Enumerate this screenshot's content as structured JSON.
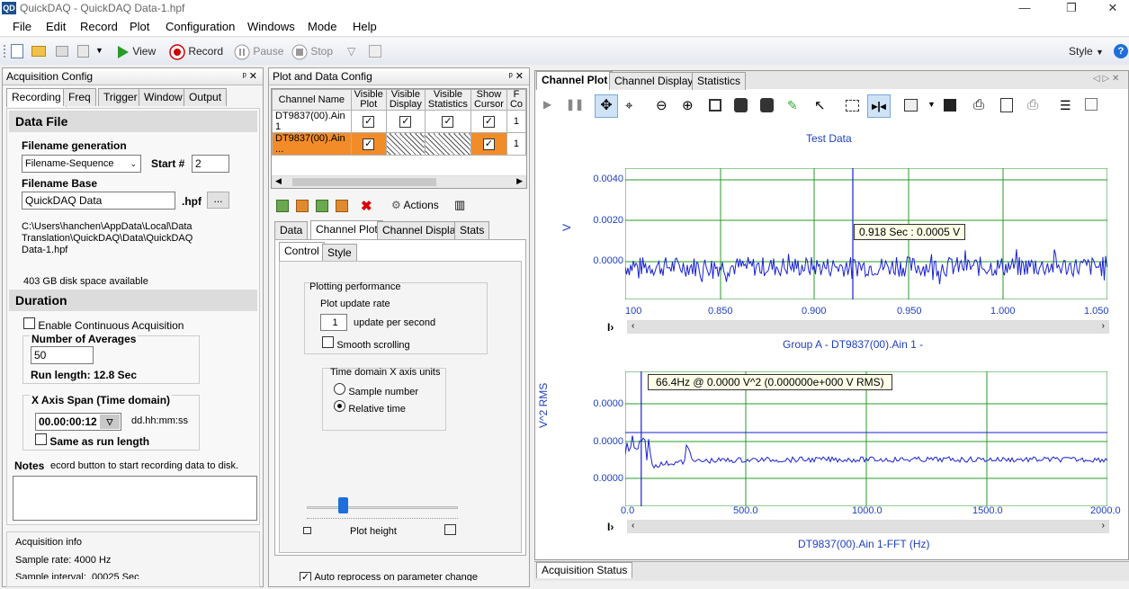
{
  "window": {
    "title": "QuickDAQ - QuickDAQ Data-1.hpf",
    "icon_text": "QD",
    "controls": [
      "—",
      "❐",
      "✕"
    ]
  },
  "menu": [
    "File",
    "Edit",
    "Record",
    "Plot",
    "Configuration",
    "Windows",
    "Mode",
    "Help"
  ],
  "toolbar": {
    "view": "View",
    "record": "Record",
    "pause": "Pause",
    "stop": "Stop",
    "style": "Style"
  },
  "acq_config": {
    "title": "Acquisition Config",
    "tabs": [
      "Recording",
      "Freq",
      "Trigger",
      "Window",
      "Output"
    ],
    "data_file": "Data File",
    "filename_generation": "Filename generation",
    "filename_mode": "Filename-Sequence",
    "start_label": "Start #",
    "start_value": "2",
    "filename_base_label": "Filename Base",
    "filename_base": "QuickDAQ Data",
    "ext": ".hpf",
    "browse": "...",
    "path_lines": [
      "C:\\Users\\hanchen\\AppData\\Local\\Data",
      "Translation\\QuickDAQ\\Data\\QuickDAQ",
      "Data-1.hpf"
    ],
    "disk_space": "403 GB disk space available",
    "duration": "Duration",
    "enable_continuous": "Enable Continuous Acquisition",
    "num_averages_label": "Number of Averages",
    "num_averages": "50",
    "run_length": "Run length: 12.8 Sec",
    "x_axis_span_label": "X Axis Span (Time domain)",
    "x_axis_span": "00.00:00:12",
    "x_axis_fmt": "dd.hh:mm:ss",
    "same_as_run": "Same as run length",
    "notes_label": "Notes",
    "notes_hint": "ecord button to start recording data to disk.",
    "acq_info": "Acquisition info",
    "sample_rate": "Sample rate: 4000 Hz",
    "sample_interval": "Sample interval: .00025 Sec"
  },
  "plot_data_config": {
    "title": "Plot and Data Config",
    "columns": [
      "Channel Name",
      "Visible Plot",
      "Visible Display",
      "Visible Statistics",
      "Show Cursor",
      "F Co"
    ],
    "rows": [
      {
        "name": "DT9837(00).Ain 1",
        "plot": true,
        "display": true,
        "stats": true,
        "cursor": true,
        "extra": "1"
      },
      {
        "name": "DT9837(00).Ain ...",
        "plot": true,
        "display": null,
        "stats": null,
        "cursor": true,
        "extra": "1"
      }
    ],
    "actions": "Actions",
    "subtabs": [
      "Data",
      "Channel Plot",
      "Channel Display",
      "Stats"
    ],
    "inner_tabs": [
      "Control",
      "Style"
    ],
    "plotting_performance": "Plotting performance",
    "plot_update_rate": "Plot update rate",
    "update_value": "1",
    "update_unit": "update per second",
    "smooth_scrolling": "Smooth scrolling",
    "time_domain_units": "Time domain X axis units",
    "sample_number": "Sample number",
    "relative_time": "Relative time",
    "plot_height": "Plot height",
    "auto_reprocess": "Auto reprocess on parameter change"
  },
  "right_tabs": [
    "Channel Plot",
    "Channel Display",
    "Statistics"
  ],
  "bottom_tab": "Acquisition Status",
  "colors": {
    "accent": "#1f3fbf",
    "selected_row": "#f28c28",
    "grid": "#2a9a2a",
    "trace": "#1a22d0"
  },
  "chart_data": [
    {
      "type": "line",
      "title": "Test Data",
      "ylabel": "V",
      "xlabel": "Group A - DT9837(00).Ain 1 -",
      "x_ticks": [
        "100",
        "0.850",
        "0.900",
        "0.950",
        "1.000",
        "1.050"
      ],
      "y_ticks": [
        "0.0040",
        "0.0020",
        "0.0000"
      ],
      "xlim": [
        0.8,
        1.05
      ],
      "ylim": [
        -0.0008,
        0.0044
      ],
      "cursor_x": 0.918,
      "cursor_label": "0.918 Sec :  0.0005 V",
      "series": [
        {
          "values_note": "noise",
          "mean": 0.0005,
          "amplitude": 0.0004
        }
      ]
    },
    {
      "type": "line",
      "ylabel": "V^2 RMS",
      "xlabel": "DT9837(00).Ain 1-FFT (Hz)",
      "x_ticks": [
        "0.0",
        "500.0",
        "1000.0",
        "1500.0",
        "2000.0"
      ],
      "y_ticks": [
        "0.0000",
        "0.0000",
        "0.0000"
      ],
      "xlim": [
        0,
        2000
      ],
      "cursor_x": 66.4,
      "cursor_label": "66.4Hz @ 0.0000 V^2 (0.000000e+000 V RMS)"
    }
  ]
}
